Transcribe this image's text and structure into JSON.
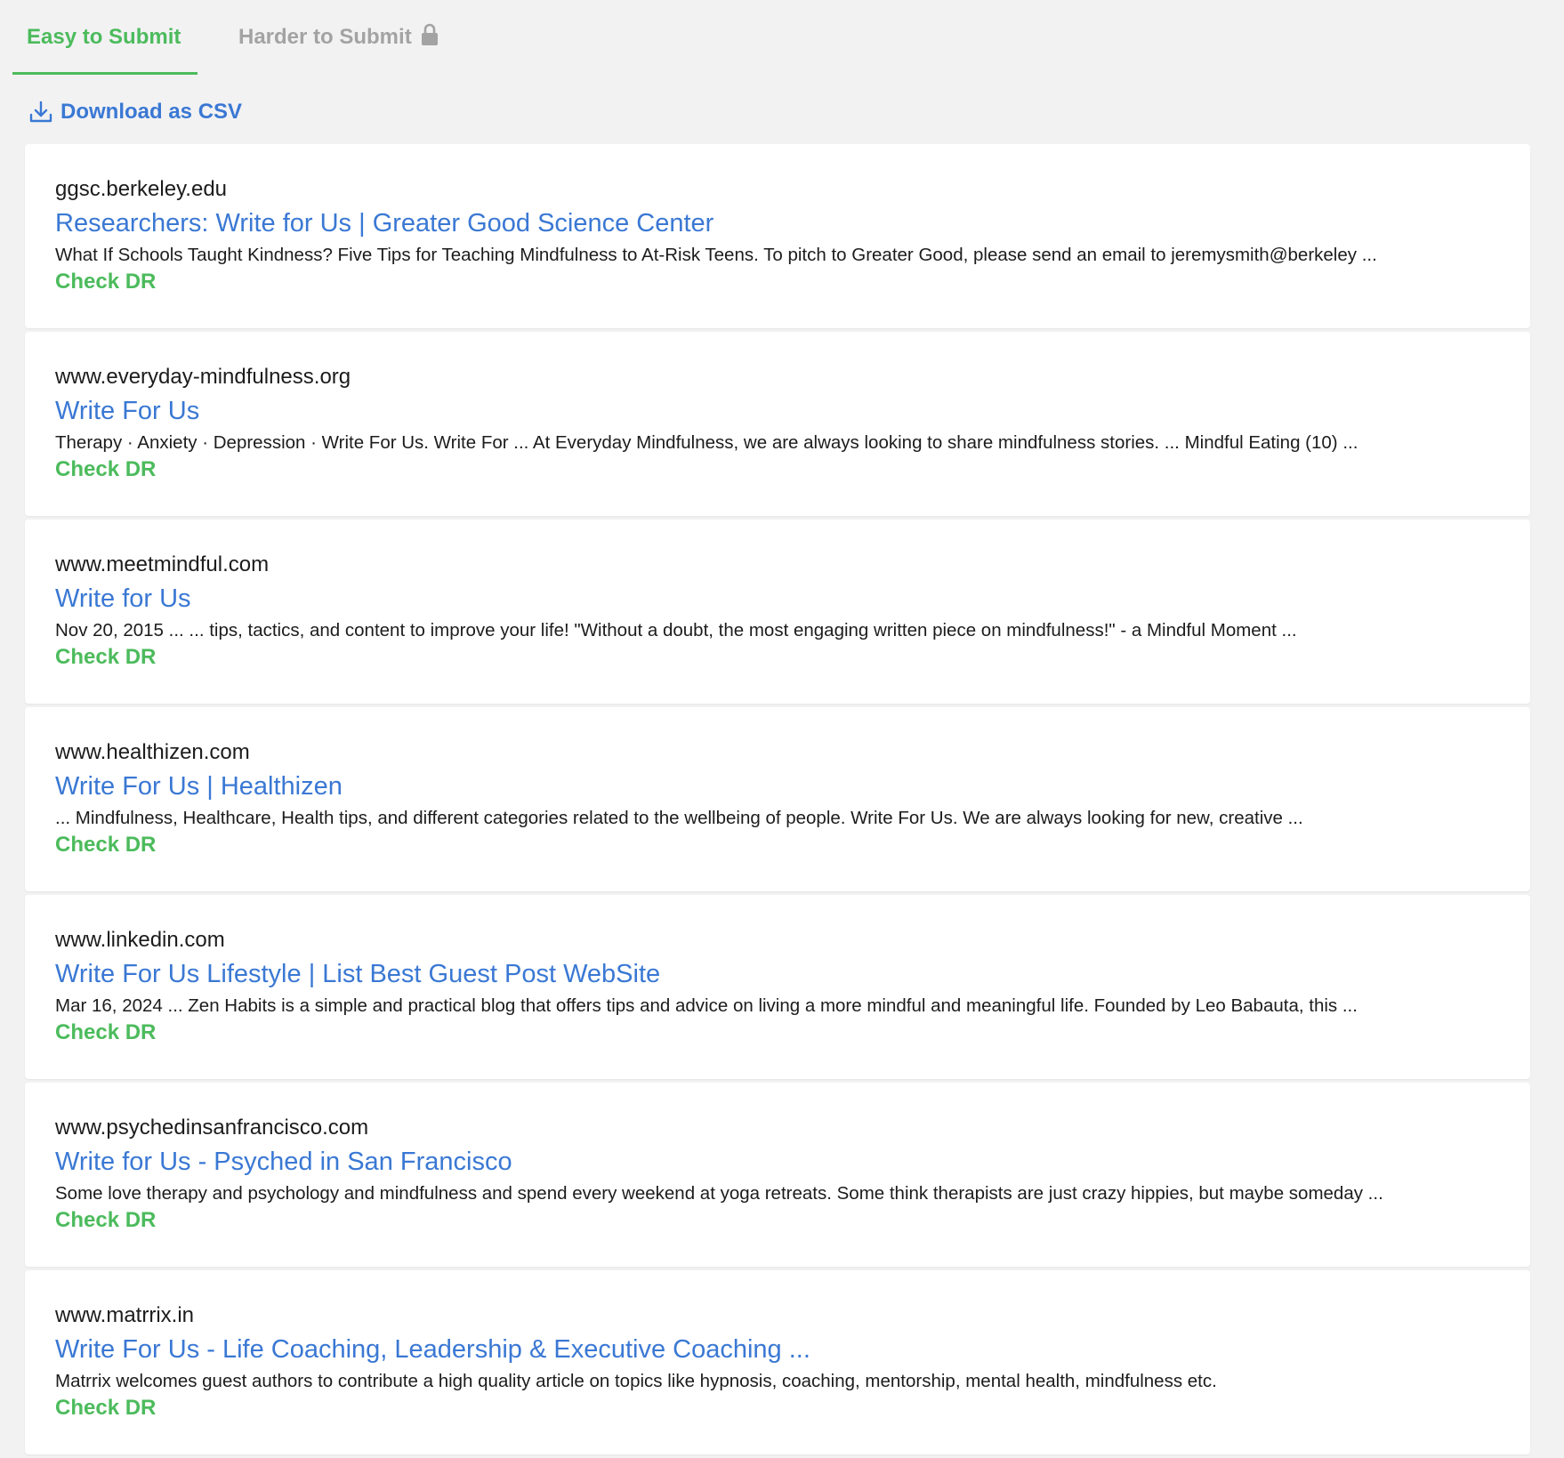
{
  "tabs": [
    {
      "label": "Easy to Submit",
      "active": true
    },
    {
      "label": "Harder to Submit",
      "icon": "lock-icon",
      "active": false
    }
  ],
  "download": {
    "label": "Download as CSV",
    "icon": "download-icon"
  },
  "colors": {
    "accent_green": "#4cbb5c",
    "link_blue": "#3a78d4",
    "inactive_gray": "#a3a3a3",
    "background": "#f2f2f3"
  },
  "results": [
    {
      "domain": "ggsc.berkeley.edu",
      "title": "Researchers: Write for Us | Greater Good Science Center",
      "snippet": "What If Schools Taught Kindness? Five Tips for Teaching Mindfulness to At-Risk Teens. To pitch to Greater Good, please send an email to jeremysmith@berkeley ...",
      "action": "Check DR"
    },
    {
      "domain": "www.everyday-mindfulness.org",
      "title": "Write For Us",
      "snippet": "Therapy · Anxiety · Depression · Write For Us. Write For ... At Everyday Mindfulness, we are always looking to share mindfulness stories. ... Mindful Eating (10) ...",
      "action": "Check DR"
    },
    {
      "domain": "www.meetmindful.com",
      "title": "Write for Us",
      "snippet": "Nov 20, 2015 ... ... tips, tactics, and content to improve your life! \"Without a doubt, the most engaging written piece on mindfulness!\" - a Mindful Moment ...",
      "action": "Check DR"
    },
    {
      "domain": "www.healthizen.com",
      "title": "Write For Us | Healthizen",
      "snippet": "... Mindfulness, Healthcare, Health tips, and different categories related to the wellbeing of people. Write For Us. We are always looking for new, creative ...",
      "action": "Check DR"
    },
    {
      "domain": "www.linkedin.com",
      "title": "Write For Us Lifestyle | List Best Guest Post WebSite",
      "snippet": "Mar 16, 2024 ... Zen Habits is a simple and practical blog that offers tips and advice on living a more mindful and meaningful life. Founded by Leo Babauta, this ...",
      "action": "Check DR"
    },
    {
      "domain": "www.psychedinsanfrancisco.com",
      "title": "Write for Us - Psyched in San Francisco",
      "snippet": "Some love therapy and psychology and mindfulness and spend every weekend at yoga retreats. Some think therapists are just crazy hippies, but maybe someday ...",
      "action": "Check DR"
    },
    {
      "domain": "www.matrrix.in",
      "title": "Write For Us - Life Coaching, Leadership & Executive Coaching ...",
      "snippet": "Matrrix welcomes guest authors to contribute a high quality article on topics like hypnosis, coaching, mentorship, mental health, mindfulness etc.",
      "action": "Check DR"
    }
  ]
}
